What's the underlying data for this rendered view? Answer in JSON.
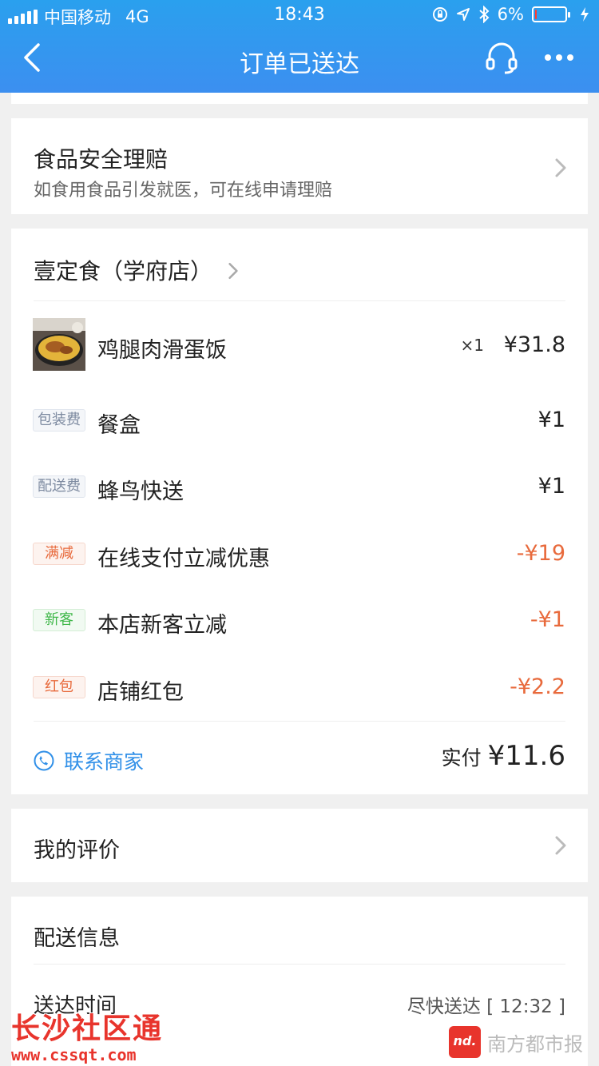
{
  "status_bar": {
    "carrier": "中国移动",
    "network": "4G",
    "time": "18:43",
    "battery": "6%",
    "battery_level": 0.06
  },
  "nav": {
    "title": "订单已送达",
    "back_icon": "back-arrow-icon",
    "cs_icon": "headset-icon",
    "more_icon": "more-dots-icon"
  },
  "claim": {
    "title": "食品安全理赔",
    "subtitle": "如食用食品引发就医，可在线申请理赔"
  },
  "order": {
    "shop_name": "壹定食（学府店）",
    "item": {
      "name": "鸡腿肉滑蛋饭",
      "qty": "×1",
      "price": "¥31.8"
    },
    "fees": [
      {
        "tag": "包装费",
        "name": "餐盒",
        "price": "¥1"
      },
      {
        "tag": "配送费",
        "name": "蜂鸟快送",
        "price": "¥1"
      }
    ],
    "discounts": [
      {
        "tag": "满减",
        "name": "在线支付立减优惠",
        "price": "-¥19"
      },
      {
        "tag": "新客",
        "name": "本店新客立减",
        "price": "-¥1"
      },
      {
        "tag": "红包",
        "name": "店铺红包",
        "price": "-¥2.2"
      }
    ],
    "contact_label": "联系商家",
    "paid_label": "实付",
    "paid_amount": "¥11.6"
  },
  "review": {
    "title": "我的评价"
  },
  "delivery": {
    "title": "配送信息",
    "time_label": "送达时间",
    "time_value": "尽快送达 [ 12:32 ]"
  },
  "watermarks": {
    "left_title": "长沙社区通",
    "left_url": "www.cssqt.com",
    "right_logo": "nd.",
    "right_name": "南方都市报"
  },
  "colors": {
    "header": "#3a93f0",
    "accent_blue": "#3190e8",
    "discount_red": "#e86a3c",
    "green": "#41b84b"
  }
}
